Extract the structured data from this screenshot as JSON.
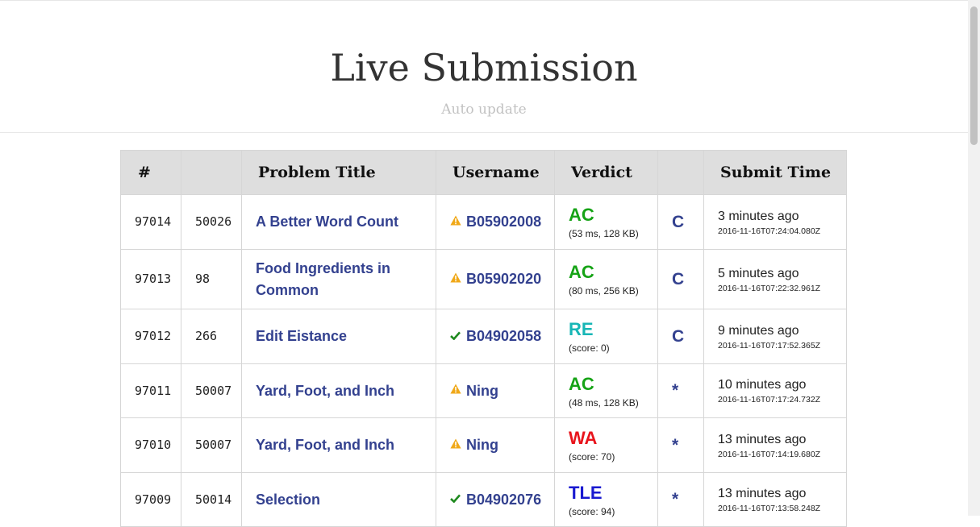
{
  "header": {
    "title": "Live Submission",
    "subtitle": "Auto update"
  },
  "table": {
    "columns": [
      "#",
      "",
      "Problem Title",
      "Username",
      "Verdict",
      "",
      "Submit Time"
    ],
    "rows": [
      {
        "id": "97014",
        "problem_id": "50026",
        "problem_title": "A Better Word Count",
        "user_status": "warning",
        "username": "B05902008",
        "verdict": "AC",
        "verdict_color": "#16a316",
        "verdict_detail": "(53 ms, 128 KB)",
        "lang": "C",
        "time_relative": "3 minutes ago",
        "time_absolute": "2016-11-16T07:24:04.080Z"
      },
      {
        "id": "97013",
        "problem_id": "98",
        "problem_title": "Food Ingredients in Common",
        "user_status": "warning",
        "username": "B05902020",
        "verdict": "AC",
        "verdict_color": "#16a316",
        "verdict_detail": "(80 ms, 256 KB)",
        "lang": "C",
        "time_relative": "5 minutes ago",
        "time_absolute": "2016-11-16T07:22:32.961Z"
      },
      {
        "id": "97012",
        "problem_id": "266",
        "problem_title": "Edit Eistance",
        "user_status": "check",
        "username": "B04902058",
        "verdict": "RE",
        "verdict_color": "#17b6b6",
        "verdict_detail": "(score: 0)",
        "lang": "C",
        "time_relative": "9 minutes ago",
        "time_absolute": "2016-11-16T07:17:52.365Z"
      },
      {
        "id": "97011",
        "problem_id": "50007",
        "problem_title": "Yard, Foot, and Inch",
        "user_status": "warning",
        "username": "Ning",
        "verdict": "AC",
        "verdict_color": "#16a316",
        "verdict_detail": "(48 ms, 128 KB)",
        "lang": "*",
        "time_relative": "10 minutes ago",
        "time_absolute": "2016-11-16T07:17:24.732Z"
      },
      {
        "id": "97010",
        "problem_id": "50007",
        "problem_title": "Yard, Foot, and Inch",
        "user_status": "warning",
        "username": "Ning",
        "verdict": "WA",
        "verdict_color": "#e8141c",
        "verdict_detail": "(score: 70)",
        "lang": "*",
        "time_relative": "13 minutes ago",
        "time_absolute": "2016-11-16T07:14:19.680Z"
      },
      {
        "id": "97009",
        "problem_id": "50014",
        "problem_title": "Selection",
        "user_status": "check",
        "username": "B04902076",
        "verdict": "TLE",
        "verdict_color": "#1a1ad0",
        "verdict_detail": "(score: 94)",
        "lang": "*",
        "time_relative": "13 minutes ago",
        "time_absolute": "2016-11-16T07:13:58.248Z"
      }
    ]
  },
  "colors": {
    "link": "#33418f",
    "warning_icon": "#f0a818",
    "check_icon": "#1f8a1f",
    "header_bg": "#dedede"
  }
}
